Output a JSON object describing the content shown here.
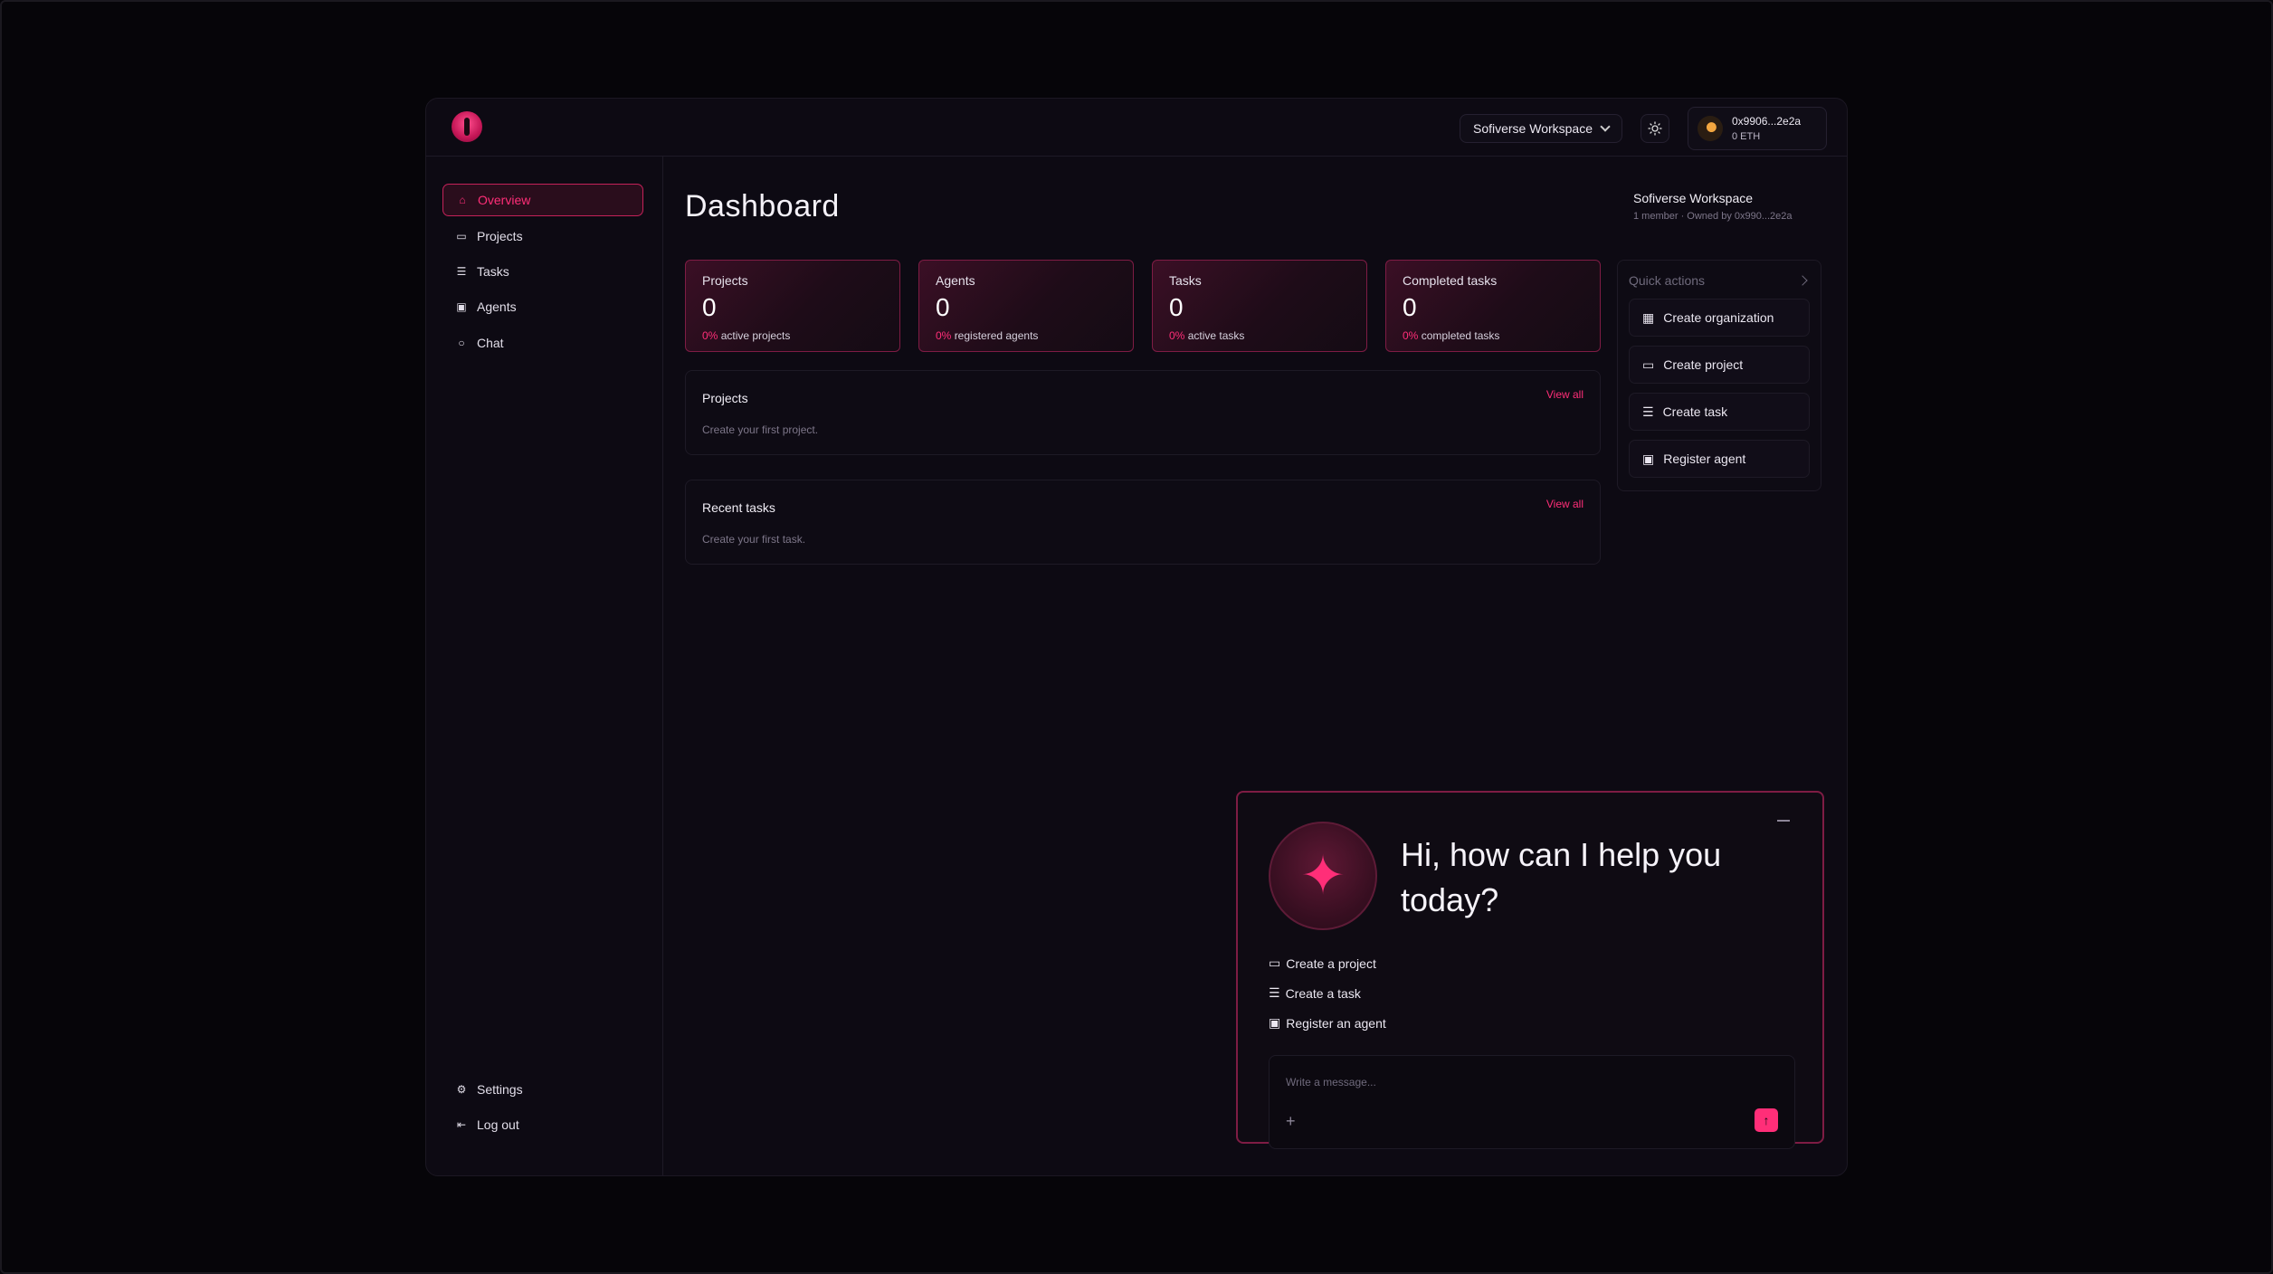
{
  "header": {
    "workspace_select": "Sofiverse Workspace",
    "wallet_address": "0x9906...2e2a",
    "wallet_balance": "0 ETH"
  },
  "sidebar": {
    "items": [
      {
        "label": "Overview",
        "icon": "home-icon"
      },
      {
        "label": "Projects",
        "icon": "folder-icon"
      },
      {
        "label": "Tasks",
        "icon": "list-icon"
      },
      {
        "label": "Agents",
        "icon": "robot-icon"
      },
      {
        "label": "Chat",
        "icon": "chat-bubble-icon"
      }
    ],
    "bottom": [
      {
        "label": "Settings",
        "icon": "gear-icon"
      },
      {
        "label": "Log out",
        "icon": "logout-icon"
      }
    ]
  },
  "main": {
    "title": "Dashboard",
    "workspace_name": "Sofiverse Workspace",
    "workspace_meta": "1 member · Owned by 0x990...2e2a",
    "stats": [
      {
        "label": "Projects",
        "value": "0",
        "pct": "0%",
        "sub": "active projects"
      },
      {
        "label": "Agents",
        "value": "0",
        "pct": "0%",
        "sub": "registered agents"
      },
      {
        "label": "Tasks",
        "value": "0",
        "pct": "0%",
        "sub": "active tasks"
      },
      {
        "label": "Completed tasks",
        "value": "0",
        "pct": "0%",
        "sub": "completed tasks"
      }
    ],
    "projects_panel": {
      "title": "Projects",
      "link": "View all",
      "empty": "Create your first project."
    },
    "tasks_panel": {
      "title": "Recent tasks",
      "link": "View all",
      "empty": "Create your first task."
    },
    "quick_actions": {
      "title": "Quick actions",
      "items": [
        {
          "label": "Create organization",
          "icon": "building-icon"
        },
        {
          "label": "Create project",
          "icon": "folder-icon"
        },
        {
          "label": "Create task",
          "icon": "list-icon"
        },
        {
          "label": "Register agent",
          "icon": "robot-icon"
        }
      ]
    }
  },
  "chat": {
    "greeting": "Hi, how can I help you today?",
    "options": [
      {
        "label": "Create a project",
        "icon": "folder-icon"
      },
      {
        "label": "Create a task",
        "icon": "list-icon"
      },
      {
        "label": "Register an agent",
        "icon": "robot-icon"
      }
    ],
    "placeholder": "Write a message..."
  },
  "colors": {
    "accent": "#ff2e78",
    "background": "#0d0a13",
    "border_accent": "#7e1c44"
  }
}
